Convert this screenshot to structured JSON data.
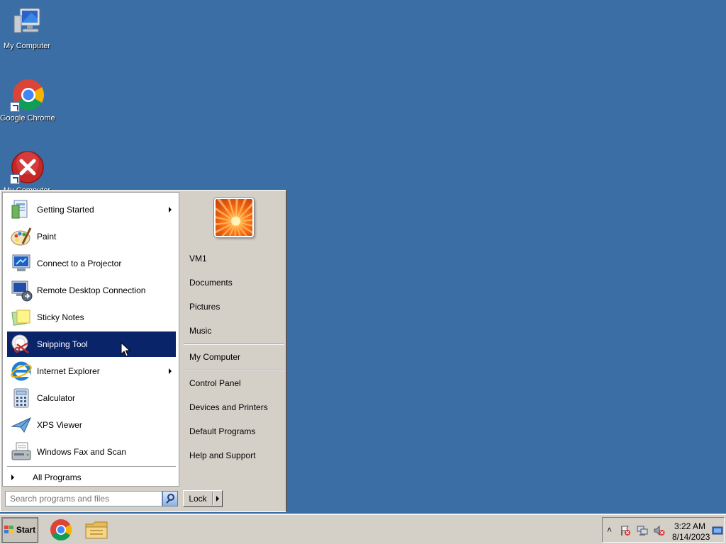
{
  "desktop": {
    "icons": [
      {
        "label": "My Computer"
      },
      {
        "label": "Google Chrome"
      },
      {
        "label": "My Computer"
      }
    ]
  },
  "start_menu": {
    "programs": [
      {
        "label": "Getting Started",
        "icon": "getting-started-icon",
        "submenu": true
      },
      {
        "label": "Paint",
        "icon": "paint-icon",
        "submenu": false
      },
      {
        "label": "Connect to a Projector",
        "icon": "projector-icon",
        "submenu": false
      },
      {
        "label": "Remote Desktop Connection",
        "icon": "remote-desktop-icon",
        "submenu": false
      },
      {
        "label": "Sticky Notes",
        "icon": "sticky-notes-icon",
        "submenu": false
      },
      {
        "label": "Snipping Tool",
        "icon": "snipping-tool-icon",
        "submenu": false,
        "selected": true
      },
      {
        "label": "Internet Explorer",
        "icon": "internet-explorer-icon",
        "submenu": true
      },
      {
        "label": "Calculator",
        "icon": "calculator-icon",
        "submenu": false
      },
      {
        "label": "XPS Viewer",
        "icon": "xps-viewer-icon",
        "submenu": false
      },
      {
        "label": "Windows Fax and Scan",
        "icon": "fax-scan-icon",
        "submenu": false
      }
    ],
    "all_programs": "All Programs",
    "right_items": {
      "user": "VM1",
      "documents": "Documents",
      "pictures": "Pictures",
      "music": "Music",
      "my_computer": "My Computer",
      "control_panel": "Control Panel",
      "devices_printers": "Devices and Printers",
      "default_programs": "Default Programs",
      "help_support": "Help and Support"
    },
    "search_placeholder": "Search programs and files",
    "lock_label": "Lock"
  },
  "taskbar": {
    "start_label": "Start",
    "tray_chevron": "˄",
    "time": "3:22 AM",
    "date": "8/14/2023"
  },
  "colors": {
    "desktop": "#3a6ea5",
    "selection": "#0a246a",
    "chrome": "#d4d0c8"
  }
}
